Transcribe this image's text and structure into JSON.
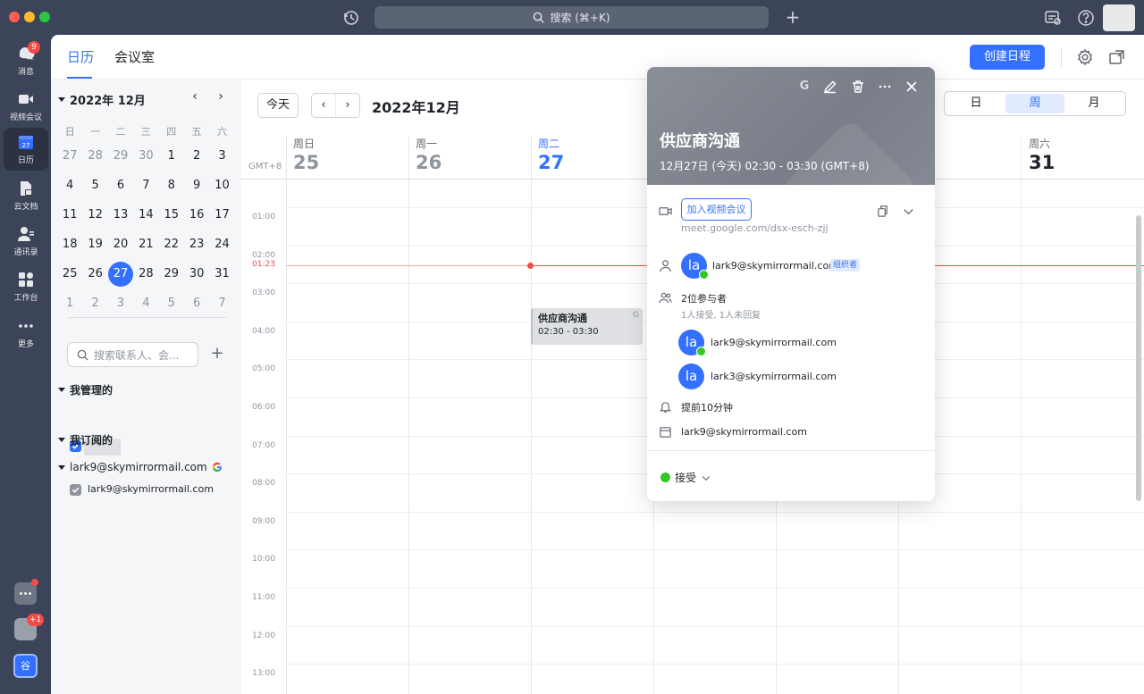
{
  "titlebar": {
    "search_label": "搜索 (⌘+K)"
  },
  "nav": {
    "messages": "消息",
    "messages_badge": "9",
    "video": "视频会议",
    "calendar": "日历",
    "calendar_icon_num": "27",
    "docs": "云文档",
    "contacts": "通讯录",
    "workspace": "工作台",
    "more": "更多",
    "bottom_badge": "+1",
    "bottom_app_label": "谷"
  },
  "top": {
    "tab_calendar": "日历",
    "tab_rooms": "会议室",
    "create_label": "创建日程"
  },
  "mini_cal": {
    "title": "2022年 12月",
    "weekdays": [
      "日",
      "一",
      "二",
      "三",
      "四",
      "五",
      "六"
    ],
    "weeks": [
      [
        "27",
        "28",
        "29",
        "30",
        "1",
        "2",
        "3"
      ],
      [
        "4",
        "5",
        "6",
        "7",
        "8",
        "9",
        "10"
      ],
      [
        "11",
        "12",
        "13",
        "14",
        "15",
        "16",
        "17"
      ],
      [
        "18",
        "19",
        "20",
        "21",
        "22",
        "23",
        "24"
      ],
      [
        "25",
        "26",
        "27",
        "28",
        "29",
        "30",
        "31"
      ],
      [
        "1",
        "2",
        "3",
        "4",
        "5",
        "6",
        "7"
      ]
    ],
    "today": "27"
  },
  "sidebar": {
    "search_placeholder": "搜索联系人、会...",
    "managed_label": "我管理的",
    "subscribed_label": "我订阅的",
    "google_account": "lark9@skymirrormail.com",
    "google_calendar_item": "lark9@skymirrormail.com"
  },
  "calendar": {
    "today_btn": "今天",
    "month_title": "2022年12月",
    "view_day": "日",
    "view_week": "周",
    "view_month": "月",
    "timezone": "GMT+8",
    "days": [
      {
        "weekday": "周日",
        "num": "25"
      },
      {
        "weekday": "周一",
        "num": "26"
      },
      {
        "weekday": "周二",
        "num": "27"
      },
      {
        "weekday": "周六",
        "num": "31"
      }
    ],
    "hours": [
      "01:00",
      "02:00",
      "03:00",
      "04:00",
      "05:00",
      "06:00",
      "07:00",
      "08:00",
      "09:00",
      "10:00",
      "11:00",
      "12:00",
      "13:00"
    ],
    "now_label": "01:23",
    "event": {
      "title": "供应商沟通",
      "time": "02:30 - 03:30",
      "source": "G"
    }
  },
  "popup": {
    "title": "供应商沟通",
    "time": "12月27日 (今天) 02:30 - 03:30 (GMT+8)",
    "join_label": "加入视频会议",
    "meet_link": "meet.google.com/dsx-esch-zjj",
    "organizer_initials": "la",
    "organizer_email": "lark9@skymirrormail.com",
    "organizer_tag": "组织者",
    "attendee_count": "2位参与者",
    "attendee_status": "1人接受, 1人未回复",
    "attendees": [
      {
        "initials": "la",
        "email": "lark9@skymirrormail.com"
      },
      {
        "initials": "la",
        "email": "lark3@skymirrormail.com"
      }
    ],
    "reminder": "提前10分钟",
    "calendar_owner": "lark9@skymirrormail.com",
    "rsvp": "接受",
    "google_tool": "G"
  }
}
